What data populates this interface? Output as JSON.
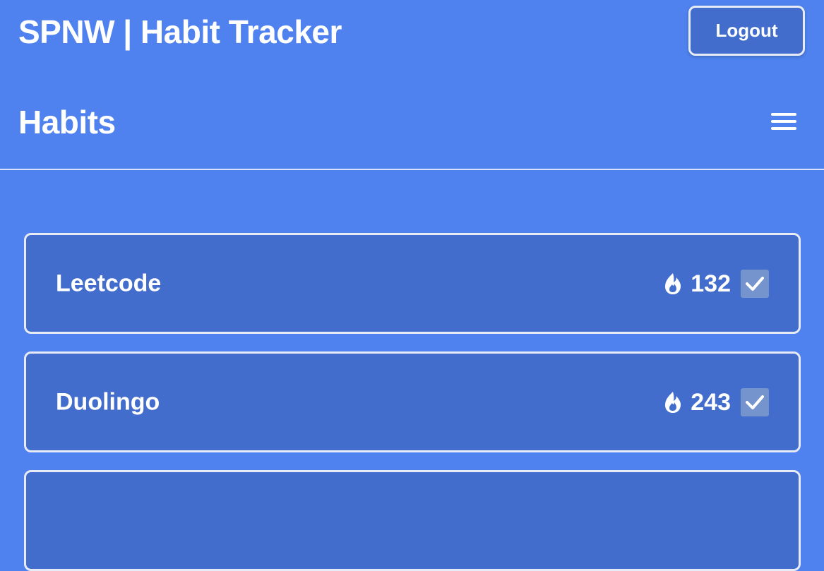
{
  "header": {
    "app_title": "SPNW | Habit Tracker",
    "logout_label": "Logout"
  },
  "page": {
    "title": "Habits",
    "menu_icon": "hamburger-menu-icon"
  },
  "habits": [
    {
      "name": "Leetcode",
      "streak_icon": "flame-icon",
      "streak": "132",
      "checked": true
    },
    {
      "name": "Duolingo",
      "streak_icon": "flame-icon",
      "streak": "243",
      "checked": true
    }
  ],
  "colors": {
    "background": "#4f82ee",
    "card": "#426dcd",
    "border": "#e6ebf5",
    "checkbox": "#7593cc",
    "text": "#ffffff"
  }
}
